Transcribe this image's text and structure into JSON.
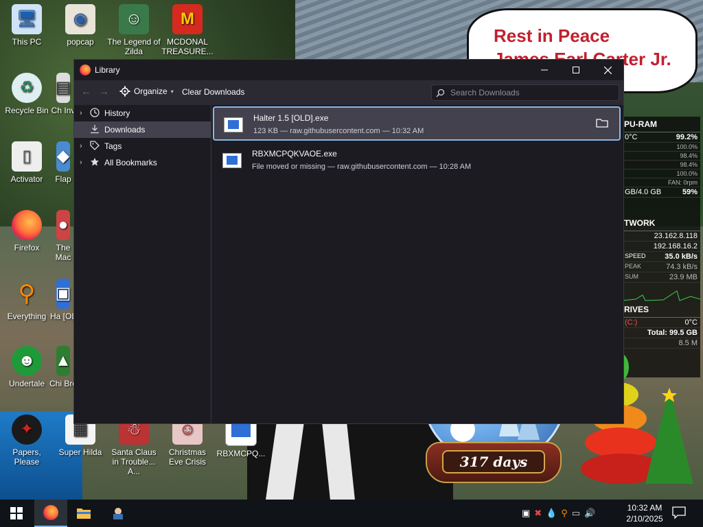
{
  "wallpaper": {
    "bubble_line1": "Rest in Peace",
    "bubble_line2": "James Earl Carter Jr.",
    "snowglobe_days": "317 days"
  },
  "desktop_icons": [
    {
      "label": "This PC",
      "icon": "computer-icon"
    },
    {
      "label": "popcap",
      "icon": "folder-icon"
    },
    {
      "label": "The Legend of Zilda",
      "icon": "game-icon"
    },
    {
      "label": "MCDONAL TREASURE...",
      "icon": "game-icon"
    },
    {
      "label": "Recycle Bin",
      "icon": "recycle-bin-icon"
    },
    {
      "label": "Ch Inv",
      "icon": "app-icon"
    },
    {
      "label": "Activator",
      "icon": "app-icon"
    },
    {
      "label": "Flap",
      "icon": "app-icon"
    },
    {
      "label": "Firefox",
      "icon": "firefox-icon"
    },
    {
      "label": "The Mac",
      "icon": "app-icon"
    },
    {
      "label": "Everything",
      "icon": "search-app-icon"
    },
    {
      "label": "Ha [OL",
      "icon": "app-icon"
    },
    {
      "label": "Undertale",
      "icon": "game-icon"
    },
    {
      "label": "Chi Bro",
      "icon": "app-icon"
    },
    {
      "label": "Papers, Please",
      "icon": "game-icon"
    },
    {
      "label": "Super Hilda",
      "icon": "game-icon"
    },
    {
      "label": "Santa Claus in Trouble... A...",
      "icon": "game-icon"
    },
    {
      "label": "Christmas Eve Crisis",
      "icon": "game-icon"
    },
    {
      "label": "RBXMCPQ...",
      "icon": "exe-icon"
    }
  ],
  "rainmeter": {
    "cpu_ram_title": "PU-RAM",
    "cpu_temp": "0°C",
    "cpu_total": "99.2%",
    "cores": [
      "100.0%",
      "98.4%",
      "98.4%",
      "100.0%"
    ],
    "fan": "FAN: 0rpm",
    "ram_usage": "GB/4.0 GB",
    "ram_percent": "59%",
    "network_title": "TWORK",
    "ip_public": "23.162.8.118",
    "ip_local": "192.168.16.2",
    "speed_label": "SPEED",
    "speed_value": "35.0 kB/s",
    "peak_label": "PEAK",
    "peak_value": "74.3 kB/s",
    "sum_label": "SUM",
    "sum_value": "23.9 MB",
    "drives_title": "RIVES",
    "drive_letter": "(C:)",
    "drive_temp": "0°C",
    "drive_total": "Total: 99.5 GB",
    "drive_free": "8.5 M"
  },
  "library": {
    "title": "Library",
    "toolbar": {
      "organize_label": "Organize",
      "clear_label": "Clear Downloads",
      "search_placeholder": "Search Downloads"
    },
    "sidebar": [
      {
        "label": "History",
        "icon": "clock-icon",
        "expandable": true,
        "selected": false
      },
      {
        "label": "Downloads",
        "icon": "download-icon",
        "expandable": false,
        "selected": true
      },
      {
        "label": "Tags",
        "icon": "tag-icon",
        "expandable": true,
        "selected": false
      },
      {
        "label": "All Bookmarks",
        "icon": "star-icon",
        "expandable": true,
        "selected": false
      }
    ],
    "downloads": [
      {
        "name": "Halter 1.5 [OLD].exe",
        "status": "123 KB — raw.githubusercontent.com — 10:32 AM",
        "selected": true
      },
      {
        "name": "RBXMCPQKVAOE.exe",
        "status": "File moved or missing — raw.githubusercontent.com — 10:28 AM",
        "selected": false
      }
    ]
  },
  "taskbar": {
    "clock_time": "10:32 AM",
    "clock_date": "2/10/2025"
  }
}
